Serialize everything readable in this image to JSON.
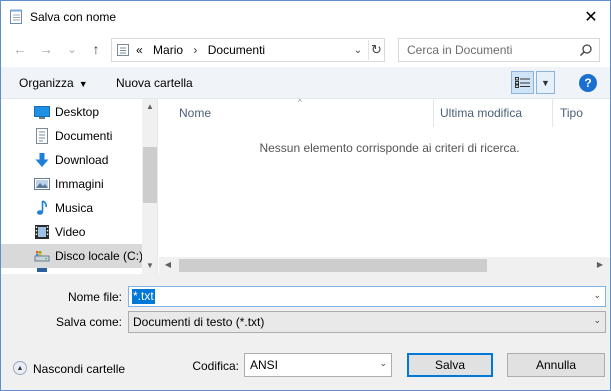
{
  "window": {
    "title": "Salva con nome",
    "close_glyph": "✕"
  },
  "nav": {
    "back_glyph": "←",
    "forward_glyph": "→",
    "recent_glyph": "⌄",
    "up_glyph": "↑",
    "breadcrumb": {
      "overflow": "«",
      "items": [
        "Mario",
        "Documenti"
      ],
      "separator": "›"
    },
    "address_drop_glyph": "⌄",
    "refresh_glyph": "↻",
    "search_placeholder": "Cerca in Documenti"
  },
  "toolbar": {
    "organize_label": "Organizza",
    "organize_caret": "▼",
    "new_folder_label": "Nuova cartella",
    "view_drop_glyph": "▼",
    "help_glyph": "?"
  },
  "sidebar": {
    "items": [
      {
        "label": "Desktop",
        "icon": "desktop-icon"
      },
      {
        "label": "Documenti",
        "icon": "document-icon"
      },
      {
        "label": "Download",
        "icon": "download-icon"
      },
      {
        "label": "Immagini",
        "icon": "pictures-icon"
      },
      {
        "label": "Musica",
        "icon": "music-icon"
      },
      {
        "label": "Video",
        "icon": "video-icon"
      },
      {
        "label": "Disco locale (C:)",
        "icon": "drive-icon",
        "selected": true
      }
    ],
    "scroll_up_glyph": "▲",
    "scroll_down_glyph": "▼"
  },
  "filelist": {
    "columns": [
      "Nome",
      "Ultima modifica",
      "Tipo"
    ],
    "sort_glyph": "^",
    "empty_message": "Nessun elemento corrisponde ai criteri di ricerca.",
    "scroll_left_glyph": "◀",
    "scroll_right_glyph": "▶"
  },
  "form": {
    "filename_label": "Nome file:",
    "filename_value": "*.txt",
    "savetype_label": "Salva come:",
    "savetype_value": "Documenti di testo (*.txt)",
    "combo_caret": "⌄",
    "hide_folders_label": "Nascondi cartelle",
    "hide_folders_glyph": "▲",
    "encoding_label": "Codifica:",
    "encoding_value": "ANSI",
    "save_button": "Salva",
    "cancel_button": "Annulla"
  },
  "colors": {
    "accent": "#0078d7",
    "toolbar_bg": "#f0f4f9",
    "bottom_bg": "#f0f0f0",
    "help": "#1a6fd1"
  }
}
